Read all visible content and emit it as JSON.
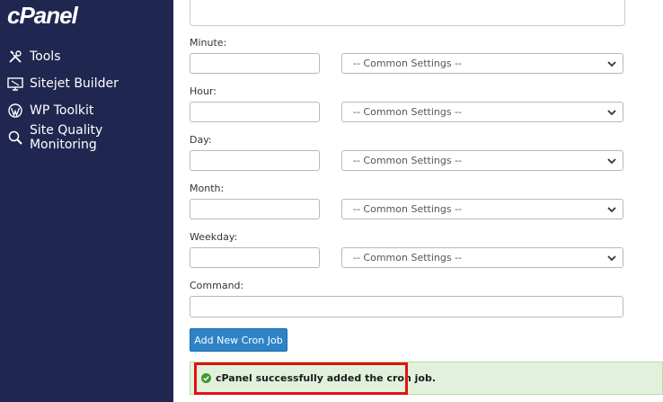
{
  "sidebar": {
    "logo": "cPanel",
    "items": [
      {
        "label": "Tools",
        "icon": "tools-icon"
      },
      {
        "label": "Sitejet Builder",
        "icon": "sitejet-icon"
      },
      {
        "label": "WP Toolkit",
        "icon": "wordpress-icon"
      },
      {
        "label": "Site Quality Monitoring",
        "icon": "magnifier-icon"
      }
    ]
  },
  "form": {
    "minute": {
      "label": "Minute:",
      "value": "",
      "select": "-- Common Settings --"
    },
    "hour": {
      "label": "Hour:",
      "value": "",
      "select": "-- Common Settings --"
    },
    "day": {
      "label": "Day:",
      "value": "",
      "select": "-- Common Settings --"
    },
    "month": {
      "label": "Month:",
      "value": "",
      "select": "-- Common Settings --"
    },
    "weekday": {
      "label": "Weekday:",
      "value": "",
      "select": "-- Common Settings --"
    },
    "command": {
      "label": "Command:",
      "value": ""
    },
    "submit_label": "Add New Cron Job"
  },
  "alert": {
    "message": "cPanel successfully added the cron job.",
    "icon": "success-check-icon"
  },
  "colors": {
    "sidebar_bg": "#1f2750",
    "button_bg": "#2e83c6",
    "alert_bg": "#e2f1dc",
    "highlight": "#e21212"
  }
}
